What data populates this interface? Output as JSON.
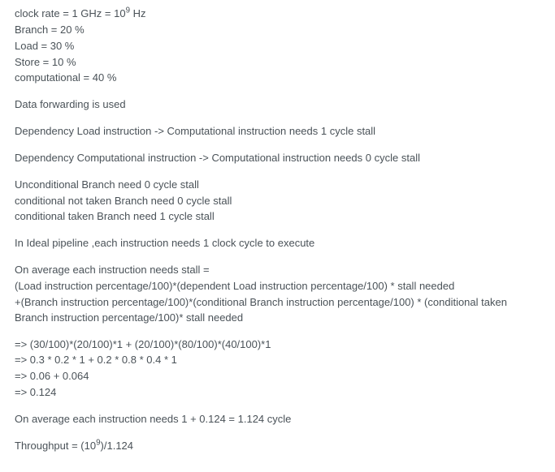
{
  "params": {
    "clock_rate": "clock rate = 1 GHz = 10",
    "clock_rate_exp": "9",
    "clock_rate_suffix": " Hz",
    "branch": "Branch = 20 %",
    "load": "Load = 30 %",
    "store": "Store = 10 %",
    "computational": "computational = 40 %"
  },
  "forwarding": "Data forwarding is used",
  "dep1": "Dependency Load instruction -> Computational instruction needs 1 cycle stall",
  "dep2": "Dependency Computational instruction -> Computational instruction needs 0 cycle stall",
  "branch_stalls": {
    "uncond": "Unconditional Branch need 0 cycle stall",
    "not_taken": "conditional not taken Branch need 0 cycle stall",
    "taken": "conditional taken Branch need 1 cycle stall"
  },
  "ideal": "In Ideal pipeline ,each instruction needs 1 clock cycle to execute",
  "avg_header": "On average each instruction needs stall =",
  "avg_formula1": "(Load instruction percentage/100)*(dependent Load instruction percentage/100) * stall needed",
  "avg_formula2": "+(Branch instruction percentage/100)*(conditional Branch instruction percentage/100) * (conditional taken Branch instruction percentage/100)* stall needed",
  "calc1": "=> (30/100)*(20/100)*1 + (20/100)*(80/100)*(40/100)*1",
  "calc2": "=> 0.3 * 0.2 * 1 + 0.2 * 0.8 * 0.4 * 1",
  "calc3": "=> 0.06 + 0.064",
  "calc4": "=> 0.124",
  "result_avg": "On average each instruction needs 1 + 0.124 = 1.124 cycle",
  "throughput_prefix": "Throughput = (10",
  "throughput_exp": "9",
  "throughput_suffix": ")/1.124"
}
